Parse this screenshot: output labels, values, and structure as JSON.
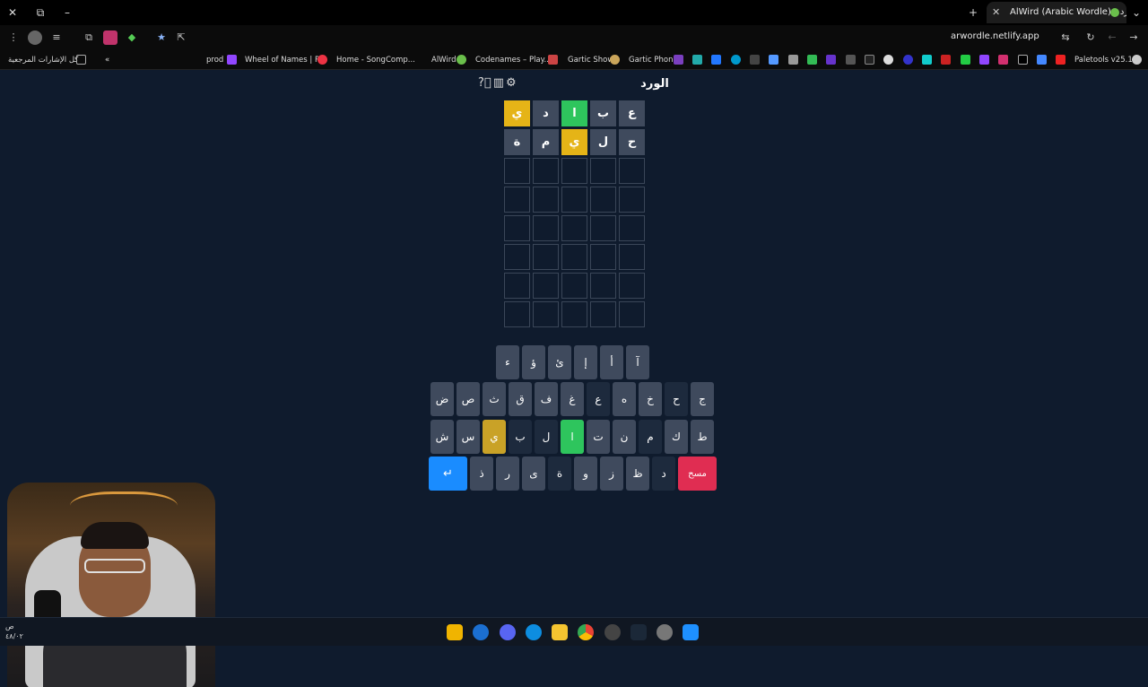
{
  "browser": {
    "tab_title": "AlWird (Arabic Wordle) - الورد",
    "url": "arwordle.netlify.app",
    "bookmarks": [
      "كل الإشارات المرجعية",
      "prod",
      "Wheel of Names | R...",
      "Home - SongComp...",
      "AlWird",
      "Codenames – Play...",
      "Gartic Show",
      "Gartic Phone",
      "Paletools v25.1.9"
    ]
  },
  "game": {
    "title": "الورد",
    "icons": [
      "help-icon",
      "stats-icon",
      "settings-icon"
    ],
    "rows": [
      [
        {
          "l": "ع",
          "s": "absent"
        },
        {
          "l": "ب",
          "s": "absent"
        },
        {
          "l": "ا",
          "s": "correct"
        },
        {
          "l": "د",
          "s": "absent"
        },
        {
          "l": "ي",
          "s": "present"
        }
      ],
      [
        {
          "l": "ح",
          "s": "absent"
        },
        {
          "l": "ل",
          "s": "absent"
        },
        {
          "l": "ي",
          "s": "present"
        },
        {
          "l": "م",
          "s": "absent"
        },
        {
          "l": "ة",
          "s": "absent"
        }
      ],
      [
        {
          "l": "",
          "s": "empty"
        },
        {
          "l": "",
          "s": "empty"
        },
        {
          "l": "",
          "s": "empty"
        },
        {
          "l": "",
          "s": "empty"
        },
        {
          "l": "",
          "s": "empty"
        }
      ],
      [
        {
          "l": "",
          "s": "empty"
        },
        {
          "l": "",
          "s": "empty"
        },
        {
          "l": "",
          "s": "empty"
        },
        {
          "l": "",
          "s": "empty"
        },
        {
          "l": "",
          "s": "empty"
        }
      ],
      [
        {
          "l": "",
          "s": "empty"
        },
        {
          "l": "",
          "s": "empty"
        },
        {
          "l": "",
          "s": "empty"
        },
        {
          "l": "",
          "s": "empty"
        },
        {
          "l": "",
          "s": "empty"
        }
      ],
      [
        {
          "l": "",
          "s": "empty"
        },
        {
          "l": "",
          "s": "empty"
        },
        {
          "l": "",
          "s": "empty"
        },
        {
          "l": "",
          "s": "empty"
        },
        {
          "l": "",
          "s": "empty"
        }
      ],
      [
        {
          "l": "",
          "s": "empty"
        },
        {
          "l": "",
          "s": "empty"
        },
        {
          "l": "",
          "s": "empty"
        },
        {
          "l": "",
          "s": "empty"
        },
        {
          "l": "",
          "s": "empty"
        }
      ],
      [
        {
          "l": "",
          "s": "empty"
        },
        {
          "l": "",
          "s": "empty"
        },
        {
          "l": "",
          "s": "empty"
        },
        {
          "l": "",
          "s": "empty"
        },
        {
          "l": "",
          "s": "empty"
        }
      ]
    ],
    "keyboard": {
      "row1": [
        {
          "k": "آ",
          "s": ""
        },
        {
          "k": "أ",
          "s": ""
        },
        {
          "k": "إ",
          "s": ""
        },
        {
          "k": "ئ",
          "s": ""
        },
        {
          "k": "ؤ",
          "s": ""
        },
        {
          "k": "ء",
          "s": ""
        }
      ],
      "row2": [
        {
          "k": "ج",
          "s": ""
        },
        {
          "k": "ح",
          "s": "absent"
        },
        {
          "k": "خ",
          "s": ""
        },
        {
          "k": "ه",
          "s": ""
        },
        {
          "k": "ع",
          "s": "absent"
        },
        {
          "k": "غ",
          "s": ""
        },
        {
          "k": "ف",
          "s": ""
        },
        {
          "k": "ق",
          "s": ""
        },
        {
          "k": "ث",
          "s": ""
        },
        {
          "k": "ص",
          "s": ""
        },
        {
          "k": "ض",
          "s": ""
        }
      ],
      "row3": [
        {
          "k": "ط",
          "s": ""
        },
        {
          "k": "ك",
          "s": ""
        },
        {
          "k": "م",
          "s": "absent"
        },
        {
          "k": "ن",
          "s": ""
        },
        {
          "k": "ت",
          "s": ""
        },
        {
          "k": "ا",
          "s": "correct"
        },
        {
          "k": "ل",
          "s": "absent"
        },
        {
          "k": "ب",
          "s": "absent"
        },
        {
          "k": "ي",
          "s": "present"
        },
        {
          "k": "س",
          "s": ""
        },
        {
          "k": "ش",
          "s": ""
        }
      ],
      "row4_delete": "مسح",
      "row4": [
        {
          "k": "د",
          "s": "absent"
        },
        {
          "k": "ظ",
          "s": ""
        },
        {
          "k": "ز",
          "s": ""
        },
        {
          "k": "و",
          "s": ""
        },
        {
          "k": "ة",
          "s": "absent"
        },
        {
          "k": "ى",
          "s": ""
        },
        {
          "k": "ر",
          "s": ""
        },
        {
          "k": "ذ",
          "s": ""
        }
      ],
      "row4_enter": "↵"
    }
  },
  "taskbar": {
    "clock_line1": "ص",
    "clock_line2": "٤٨/٠٢"
  }
}
